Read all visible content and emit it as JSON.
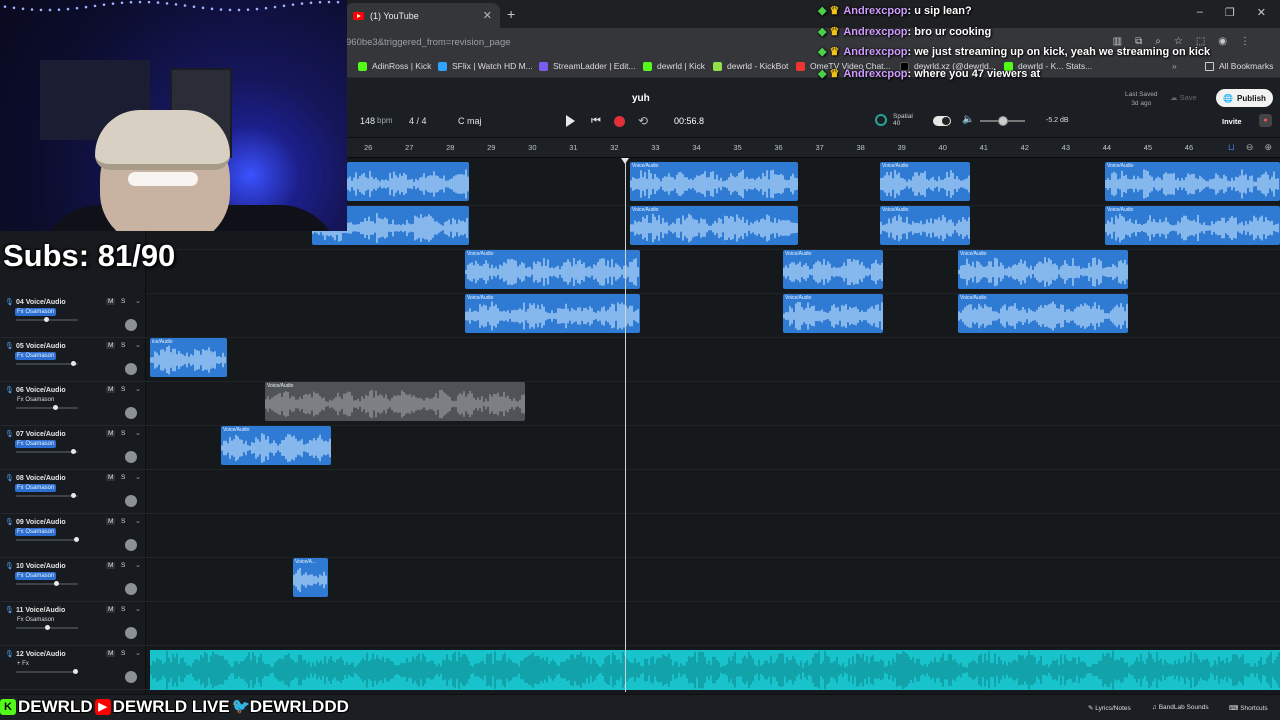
{
  "browser": {
    "tab_title": "(1) YouTube",
    "url": "960be3&triggered_from=revision_page",
    "bookmarks": [
      "AdinRoss | Kick",
      "SFlix | Watch HD M...",
      "StreamLadder | Edit...",
      "dewrld | Kick",
      "dewrld - KickBot",
      "OmeTV Video Chat...",
      "dewrld.xz (@dewrld...",
      "dewrld - K... Stats...",
      "All Bookmarks"
    ]
  },
  "daw": {
    "project_title": "yuh",
    "bpm": "148",
    "bpm_unit": "bpm",
    "time_signature": "4 / 4",
    "key": "C maj",
    "time": "00:56.8",
    "spatial_label": "Spatial",
    "spatial_sub": "40",
    "volume_db": "-5.2 dB",
    "last_saved": "Last Saved",
    "last_saved_when": "3d ago",
    "save": "Save",
    "publish": "Publish",
    "invite": "Invite",
    "bars": [
      "26",
      "27",
      "28",
      "29",
      "30",
      "31",
      "32",
      "33",
      "34",
      "35",
      "36",
      "37",
      "38",
      "39",
      "40",
      "41",
      "42",
      "43",
      "44",
      "45",
      "46"
    ],
    "tracks": [
      {
        "name": "04 Voice/Audio",
        "fx": "Fx Osamason",
        "fx_on": true
      },
      {
        "name": "05 Voice/Audio",
        "fx": "Fx Osamason",
        "fx_on": true
      },
      {
        "name": "06 Voice/Audio",
        "fx": "Fx Osamason",
        "fx_on": false
      },
      {
        "name": "07 Voice/Audio",
        "fx": "Fx Osamason",
        "fx_on": true
      },
      {
        "name": "08 Voice/Audio",
        "fx": "Fx Osamason",
        "fx_on": true
      },
      {
        "name": "09 Voice/Audio",
        "fx": "Fx Osamason",
        "fx_on": true
      },
      {
        "name": "10 Voice/Audio",
        "fx": "Fx Osamason",
        "fx_on": true
      },
      {
        "name": "11 Voice/Audio",
        "fx": "Fx Osamason",
        "fx_on": false
      },
      {
        "name": "12 Voice/Audio",
        "fx": "+ Fx",
        "fx_on": false
      }
    ],
    "mute_label": "M",
    "solo_label": "S",
    "clip_label": "Voice/Audio",
    "clip_label_short": "Voice/A...",
    "clip_label_cut": "ice/Audio",
    "footer": {
      "lyrics": "Lyrics/Notes",
      "sounds": "BandLab Sounds",
      "shortcuts": "Shortcuts"
    }
  },
  "stream": {
    "subs": "Subs: 81/90",
    "chat": [
      {
        "user": "Andrexcpop",
        "text": ": u sip lean?"
      },
      {
        "user": "Andrexcpop",
        "text": ": bro ur cooking"
      },
      {
        "user": "Andrexcpop",
        "text": ": we just streaming up on kick, yeah we streaming on kick"
      },
      {
        "user": "Andrexcpop",
        "text": ": where you 47 viewers at"
      }
    ],
    "socials": [
      {
        "platform": "kick",
        "handle": "DEWRLD"
      },
      {
        "platform": "youtube",
        "handle": "DEWRLD LIVE"
      },
      {
        "platform": "twitter",
        "handle": "DEWRLDDD"
      }
    ]
  }
}
